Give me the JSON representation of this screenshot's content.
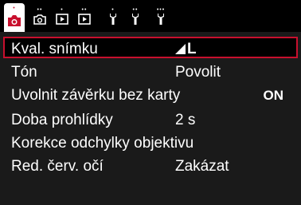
{
  "tabs": [
    {
      "icon": "camera-icon",
      "dots": "•",
      "active": true
    },
    {
      "icon": "camera-icon",
      "dots": "••",
      "active": false
    },
    {
      "icon": "playback-icon",
      "dots": "•",
      "active": false
    },
    {
      "icon": "playback-icon",
      "dots": "••",
      "active": false
    },
    {
      "icon": "wrench-icon",
      "dots": "•",
      "active": false
    },
    {
      "icon": "wrench-icon",
      "dots": "••",
      "active": false
    },
    {
      "icon": "wrench-icon",
      "dots": "•••",
      "active": false
    }
  ],
  "menu": {
    "items": [
      {
        "label": "Kval. snímku",
        "value": "L",
        "selected": true
      },
      {
        "label": "Tón",
        "value": "Povolit"
      },
      {
        "label": "Uvolnit závěrku bez karty",
        "value": "ON"
      },
      {
        "label": "Doba prohlídky",
        "value": "2 s"
      },
      {
        "label": "Korekce odchylky objektivu",
        "value": ""
      },
      {
        "label": "Red. červ. očí",
        "value": "Zakázat"
      }
    ]
  },
  "colors": {
    "accent": "#c8102e",
    "background": "#1a1a1a"
  }
}
